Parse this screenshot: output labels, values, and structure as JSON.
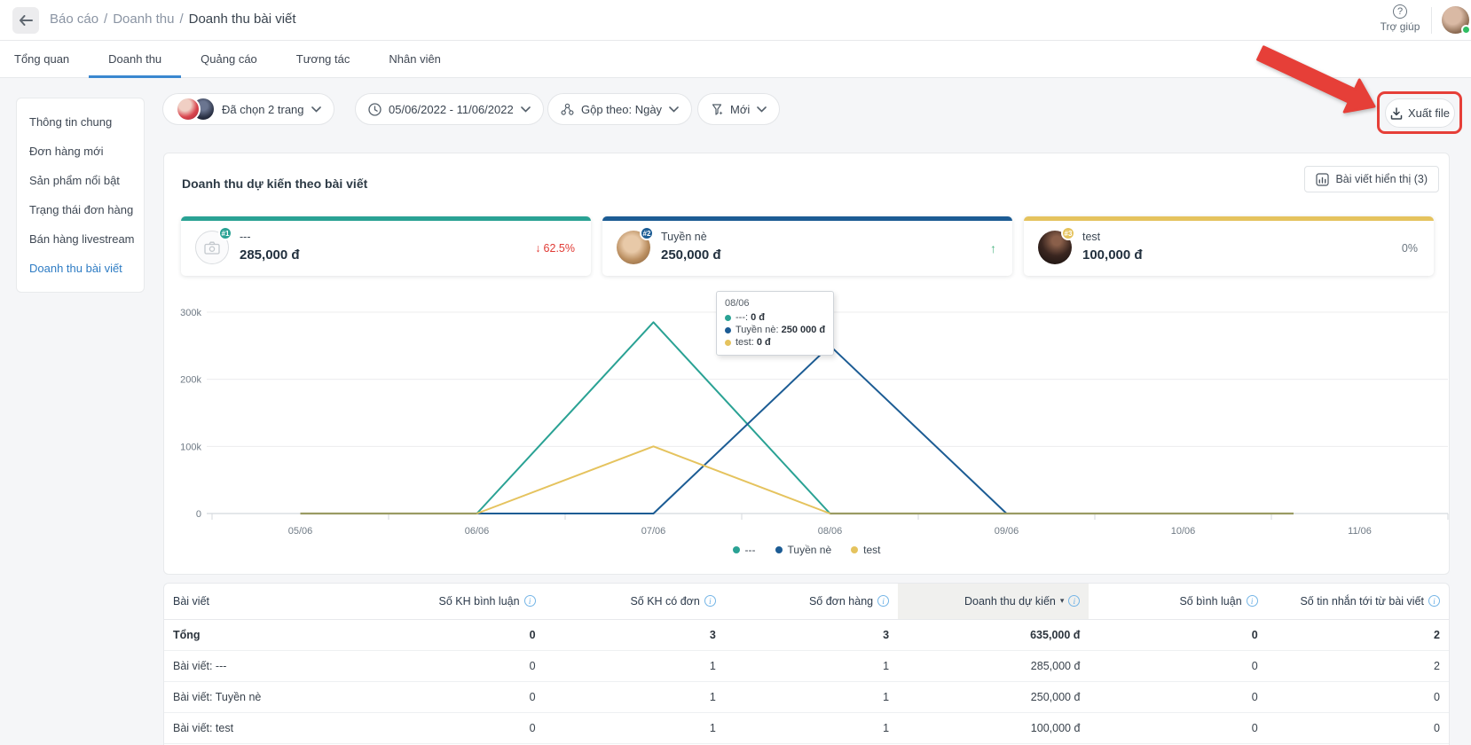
{
  "colors": {
    "accent_blue": "#3a87cf",
    "link_blue": "#2e7cc4",
    "annotation_red": "#e63f38",
    "negative_red": "#e03a34",
    "positive_green": "#4db583",
    "series_teal": "#2aa294",
    "series_navy": "#1c5c94",
    "series_yellow": "#e5c35e",
    "zero_overlap": "#9a9b63",
    "online_green": "#2fbd62"
  },
  "header": {
    "breadcrumb": {
      "parts": [
        "Báo cáo",
        "Doanh thu"
      ],
      "current": "Doanh thu bài viết",
      "separator": "/"
    },
    "help_label": "Trợ giúp"
  },
  "tabs": [
    {
      "label": "Tổng quan",
      "active": false
    },
    {
      "label": "Doanh thu",
      "active": true
    },
    {
      "label": "Quảng cáo",
      "active": false
    },
    {
      "label": "Tương tác",
      "active": false
    },
    {
      "label": "Nhân viên",
      "active": false
    }
  ],
  "sidebar": {
    "items": [
      {
        "label": "Thông tin chung",
        "active": false
      },
      {
        "label": "Đơn hàng mới",
        "active": false
      },
      {
        "label": "Sản phẩm nổi bật",
        "active": false
      },
      {
        "label": "Trạng thái đơn hàng",
        "active": false
      },
      {
        "label": "Bán hàng livestream",
        "active": false
      },
      {
        "label": "Doanh thu bài viết",
        "active": true
      }
    ]
  },
  "filters": {
    "pages": {
      "label": "Đã chọn 2 trang"
    },
    "date_range": {
      "label": "05/06/2022 - 11/06/2022"
    },
    "group_by": {
      "label": "Gộp theo: Ngày"
    },
    "new_filter": {
      "label": "Mới"
    }
  },
  "export_button": {
    "label": "Xuất file"
  },
  "chart_section": {
    "title": "Doanh thu dự kiến theo bài viết",
    "posts_visible_button": "Bài viết hiển thị (3)"
  },
  "summary_cards": [
    {
      "rank": "#1",
      "name": "---",
      "value": "285,000 đ",
      "change_icon": "↓",
      "change": "62.5%",
      "direction": "down",
      "accent": "#2aa294"
    },
    {
      "rank": "#2",
      "name": "Tuyền nè",
      "value": "250,000 đ",
      "change_icon": "↑",
      "change": "",
      "direction": "up",
      "accent": "#1c5c94"
    },
    {
      "rank": "#3",
      "name": "test",
      "value": "100,000 đ",
      "change_icon": "",
      "change": "0%",
      "direction": "neutral",
      "accent": "#e5c35e"
    }
  ],
  "chart_data": {
    "type": "line",
    "title": "Doanh thu dự kiến theo bài viết",
    "categories": [
      "05/06",
      "06/06",
      "07/06",
      "08/06",
      "09/06",
      "10/06",
      "11/06"
    ],
    "series": [
      {
        "name": "---",
        "color": "#2aa294",
        "values": [
          0,
          0,
          285000,
          0,
          0,
          0,
          0
        ]
      },
      {
        "name": "Tuyền nè",
        "color": "#1c5c94",
        "values": [
          0,
          0,
          0,
          250000,
          0,
          0,
          0
        ]
      },
      {
        "name": "test",
        "color": "#e5c35e",
        "values": [
          0,
          0,
          100000,
          0,
          0,
          0,
          0
        ]
      }
    ],
    "ylim": [
      0,
      300000
    ],
    "y_ticks": [
      {
        "label": "300k",
        "value": 300000
      },
      {
        "label": "200k",
        "value": 200000
      },
      {
        "label": "100k",
        "value": 100000
      },
      {
        "label": "0",
        "value": 0
      }
    ],
    "grid": true,
    "legend_position": "bottom",
    "zero_overlap_color": "#9a9b63"
  },
  "tooltip": {
    "date": "08/06",
    "rows": [
      {
        "label": "---",
        "value": "0 đ"
      },
      {
        "label": "Tuyền nè",
        "value": "250 000 đ"
      },
      {
        "label": "test",
        "value": "0 đ"
      }
    ]
  },
  "table": {
    "columns": [
      {
        "label": "Bài viết",
        "info": false,
        "sorted": false
      },
      {
        "label": "Số KH bình luận",
        "info": true,
        "sorted": false
      },
      {
        "label": "Số KH có đơn",
        "info": true,
        "sorted": false
      },
      {
        "label": "Số đơn hàng",
        "info": true,
        "sorted": false
      },
      {
        "label": "Doanh thu dự kiến",
        "info": true,
        "sorted": true
      },
      {
        "label": "Số bình luận",
        "info": true,
        "sorted": false
      },
      {
        "label": "Số tin nhắn tới từ bài viết",
        "info": true,
        "sorted": false
      }
    ],
    "rows": [
      {
        "label": "Tổng",
        "total": true,
        "cells": [
          "0",
          "3",
          "3",
          "635,000 đ",
          "0",
          "2"
        ]
      },
      {
        "label": "Bài viết: ---",
        "total": false,
        "cells": [
          "0",
          "1",
          "1",
          "285,000 đ",
          "0",
          "2"
        ]
      },
      {
        "label": "Bài viết: Tuyền nè",
        "total": false,
        "cells": [
          "0",
          "1",
          "1",
          "250,000 đ",
          "0",
          "0"
        ]
      },
      {
        "label": "Bài viết: test",
        "total": false,
        "cells": [
          "0",
          "1",
          "1",
          "100,000 đ",
          "0",
          "0"
        ]
      }
    ]
  }
}
